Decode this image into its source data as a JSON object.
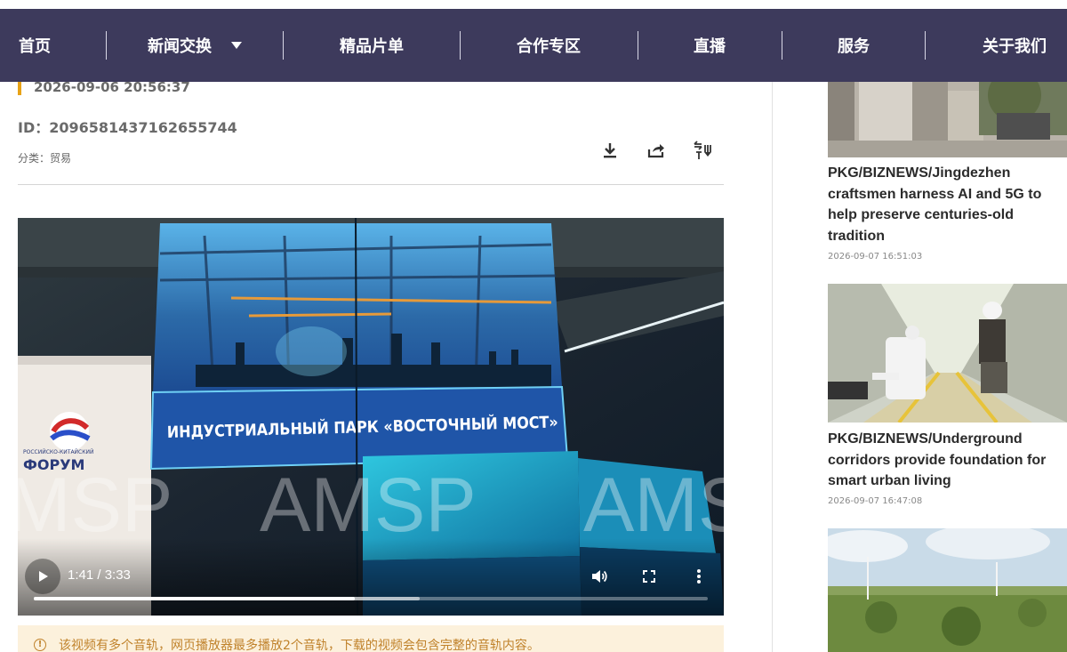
{
  "nav": {
    "items": [
      {
        "label": "首页"
      },
      {
        "label": "新闻交换"
      },
      {
        "label": "精品片单"
      },
      {
        "label": "合作专区"
      },
      {
        "label": "直播"
      },
      {
        "label": "服务"
      },
      {
        "label": "关于我们"
      }
    ]
  },
  "article": {
    "date": "2026-09-06 20:56:37",
    "id": "ID：2096581437162655744",
    "category": "分类：贸易",
    "tools": {
      "download": "download-icon",
      "share": "share-icon",
      "translate": "translate-audio-icon"
    }
  },
  "video": {
    "overlay_text": "ИНДУСТРИАЛЬНЫЙ ПАРК «ВОСТОЧНЫЙ МОСТ»",
    "watermark_1": "MSP",
    "watermark_2": "AMSP",
    "watermark_3": "AMS",
    "sign_text": "ФОРУМ",
    "sign_small": "РОССИЙСКО-КИТАЙСКИЙ",
    "time": "1:41 / 3:33",
    "progress": 0.476,
    "buffered": 0.573
  },
  "notice": {
    "icon": "!",
    "text": "该视频有多个音轨，网页播放器最多播放2个音轨，下载的视频会包含完整的音轨内容。"
  },
  "sidebar": {
    "items": [
      {
        "title": "PKG/BIZNEWS/Jingdezhen craftsmen harness AI and 5G to help preserve centuries-old tradition",
        "time": "2026-09-07 16:51:03"
      },
      {
        "title": "PKG/BIZNEWS/Underground corridors provide foundation for smart urban living",
        "time": "2026-09-07 16:47:08"
      }
    ]
  },
  "colors": {
    "nav_bg": "#3d3a5c",
    "accent": "#e8a317",
    "notice_bg": "#fcf1dc",
    "notice_text": "#c0822b"
  }
}
